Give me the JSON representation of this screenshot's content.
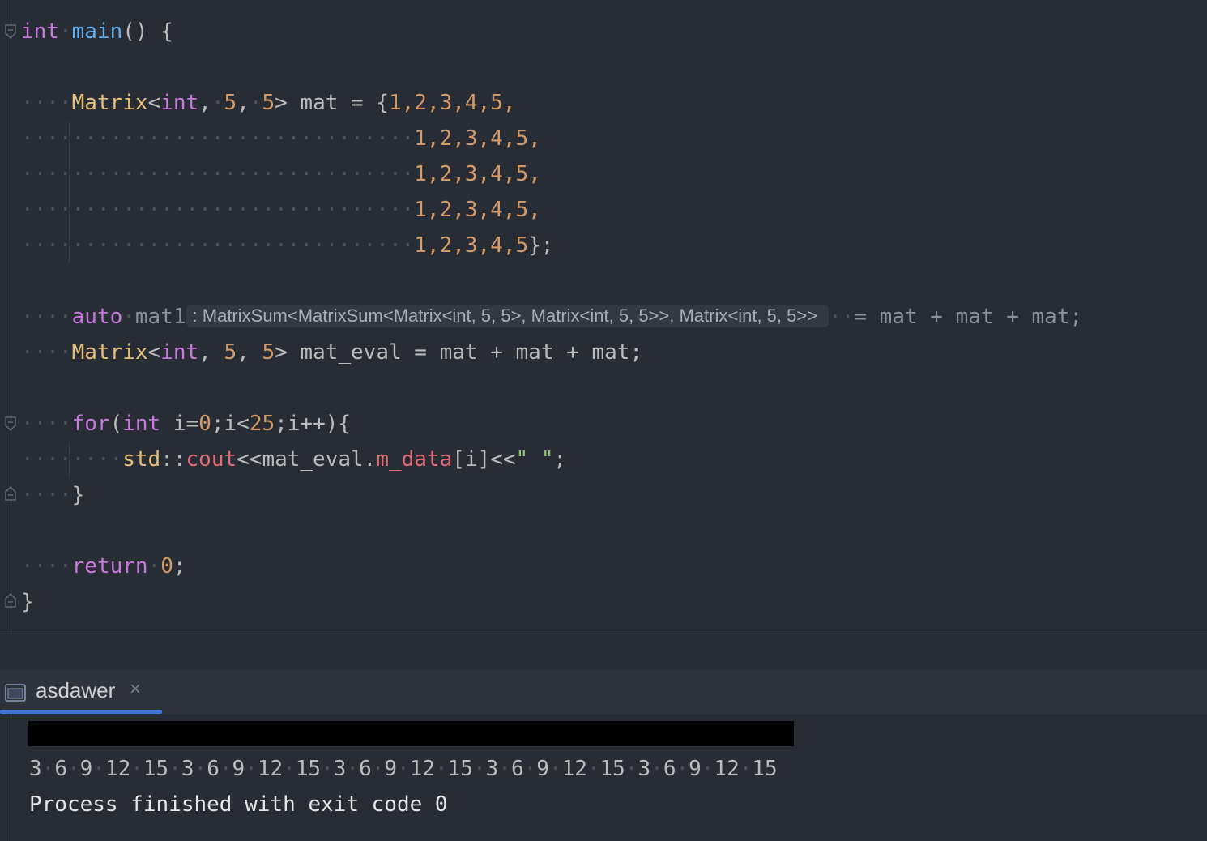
{
  "editor": {
    "line1": {
      "kw": "int",
      "fn": "main",
      "rest": "() {"
    },
    "mat_decl": {
      "type": "Matrix",
      "lt": "<",
      "int": "int",
      "c1": ",",
      "n1": "5",
      "c2": ",",
      "n2": "5",
      "rest": "> mat = {",
      "rows": [
        "1,2,3,4,5,",
        "1,2,3,4,5,",
        "1,2,3,4,5,",
        "1,2,3,4,5,",
        "1,2,3,4,5"
      ],
      "end": "};"
    },
    "auto_line": {
      "kw": "auto",
      "name": "mat1",
      "hint": ": MatrixSum<MatrixSum<Matrix<int, 5, 5>, Matrix<int, 5, 5>>, Matrix<int, 5, 5>>",
      "rest": "= mat + mat + mat;"
    },
    "eval_line": {
      "type": "Matrix",
      "lt": "<",
      "int": "int",
      "n1": "5",
      "n2": "5",
      "rest": "> mat_eval = mat + mat + mat;"
    },
    "for_line": {
      "kw": "for",
      "p1": "(",
      "int": "int",
      "mid1": " i=",
      "n0": "0",
      "mid2": ";i<",
      "n25": "25",
      "end": ";i++){"
    },
    "cout_line": {
      "std": "std",
      "sep": "::",
      "cout": "cout",
      "mid": "<<mat_eval.",
      "member": "m_data",
      "idx": "[i]<<",
      "str": "\" \"",
      "end": ";"
    },
    "for_close": "}",
    "return_line": {
      "kw": "return",
      "num": "0",
      "end": ";"
    },
    "close": "}"
  },
  "run_panel": {
    "tab_label": "asdawer",
    "close_glyph": "×"
  },
  "console": {
    "output": "3 6 9 12 15 3 6 9 12 15 3 6 9 12 15 3 6 9 12 15 3 6 9 12 15",
    "status": "Process finished with exit code 0"
  },
  "colors": {
    "background": "#282c34",
    "keyword": "#c678dd",
    "function": "#61afef",
    "type": "#e5c07b",
    "number": "#d19a66",
    "string": "#98c379",
    "member": "#e06c75",
    "tab_accent": "#3d74d6"
  }
}
